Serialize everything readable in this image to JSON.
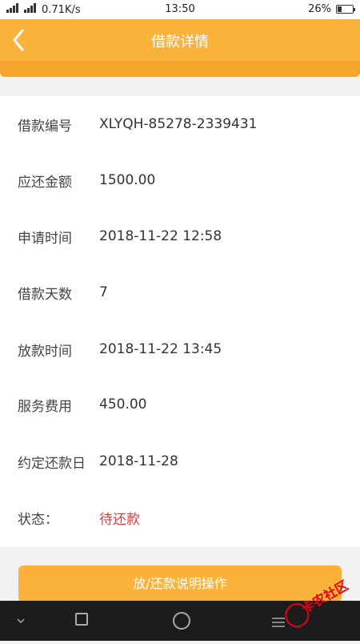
{
  "status_bar": {
    "network_speed": "0.71K/s",
    "time": "13:50",
    "battery_percent": "26%",
    "battery_level": 0.26,
    "icons": [
      "signal-icon",
      "signal-icon",
      "battery-icon"
    ]
  },
  "navbar": {
    "title": "借款详情",
    "back_icon": "chevron-left-icon"
  },
  "details": [
    {
      "label": "借款编号",
      "value": "XLYQH-85278-2339431"
    },
    {
      "label": "应还金额",
      "value": "1500.00"
    },
    {
      "label": "申请时间",
      "value": "2018-11-22 12:58"
    },
    {
      "label": "借款天数",
      "value": "7"
    },
    {
      "label": "放款时间",
      "value": "2018-11-22 13:45"
    },
    {
      "label": "服务费用",
      "value": "450.00"
    },
    {
      "label": "约定还款日",
      "value": "2018-11-28"
    },
    {
      "label": "状态：",
      "value": "待还款"
    }
  ],
  "action_button": {
    "label": "放/还款说明操作"
  },
  "watermark": {
    "text": "卡农社区"
  },
  "colors": {
    "accent": "#fbb23a",
    "status_pending": "#e23a3a"
  }
}
